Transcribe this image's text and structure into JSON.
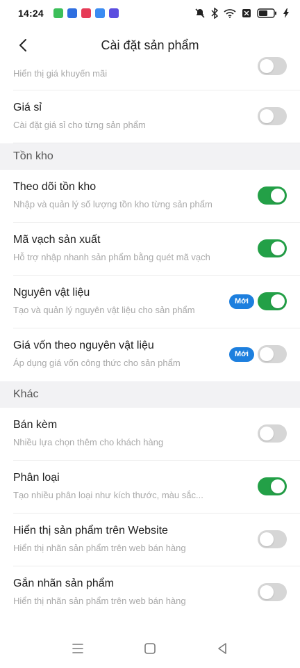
{
  "status_bar": {
    "time": "14:24",
    "app_icons": [
      {
        "name": "app-green-icon",
        "color": "#3cbf5a"
      },
      {
        "name": "app-blue-icon",
        "color": "#2f6fe0"
      },
      {
        "name": "app-red-icon",
        "color": "#e63b57"
      },
      {
        "name": "app-messenger-icon",
        "color": "#3b8cf2"
      },
      {
        "name": "app-purple-icon",
        "color": "#5b4ee0"
      }
    ]
  },
  "header": {
    "title": "Cài đặt sản phẩm"
  },
  "settings_top": [
    {
      "title": "",
      "subtitle": "Hiển thị giá khuyến mãi",
      "on": false,
      "new": false,
      "partial": true
    },
    {
      "title": "Giá sỉ",
      "subtitle": "Cài đặt giá sỉ cho từng sản phẩm",
      "on": false,
      "new": false
    }
  ],
  "section_inventory": {
    "label": "Tồn kho",
    "items": [
      {
        "title": "Theo dõi tồn kho",
        "subtitle": "Nhập và quản lý số lượng tồn kho từng sản phẩm",
        "on": true,
        "new": false
      },
      {
        "title": "Mã vạch sản xuất",
        "subtitle": "Hỗ trợ nhập nhanh sản phẩm bằng quét mã vạch",
        "on": true,
        "new": false
      },
      {
        "title": "Nguyên vật liệu",
        "subtitle": "Tạo và quản lý nguyên vật liệu cho sản phẩm",
        "on": true,
        "new": true
      },
      {
        "title": "Giá vốn theo nguyên vật liệu",
        "subtitle": "Áp dụng giá vốn công thức cho sản phẩm",
        "on": false,
        "new": true
      }
    ]
  },
  "section_other": {
    "label": "Khác",
    "items": [
      {
        "title": "Bán kèm",
        "subtitle": "Nhiều lựa chọn thêm cho khách hàng",
        "on": false,
        "new": false
      },
      {
        "title": "Phân loại",
        "subtitle": "Tạo nhiều phân loại như kích thước, màu sắc...",
        "on": true,
        "new": false
      },
      {
        "title": "Hiển thị sản phẩm trên Website",
        "subtitle": "Hiển thị nhãn sản phẩm trên web bán hàng",
        "on": false,
        "new": false
      },
      {
        "title": "Gắn nhãn sản phẩm",
        "subtitle": "Hiển thị nhãn sản phẩm trên web bán hàng",
        "on": false,
        "new": false
      }
    ]
  },
  "badge_label": "Mới",
  "colors": {
    "toggle_on": "#23a047",
    "toggle_off": "#d6d6d6",
    "badge": "#1d7fde",
    "section_bg": "#f2f2f4"
  }
}
